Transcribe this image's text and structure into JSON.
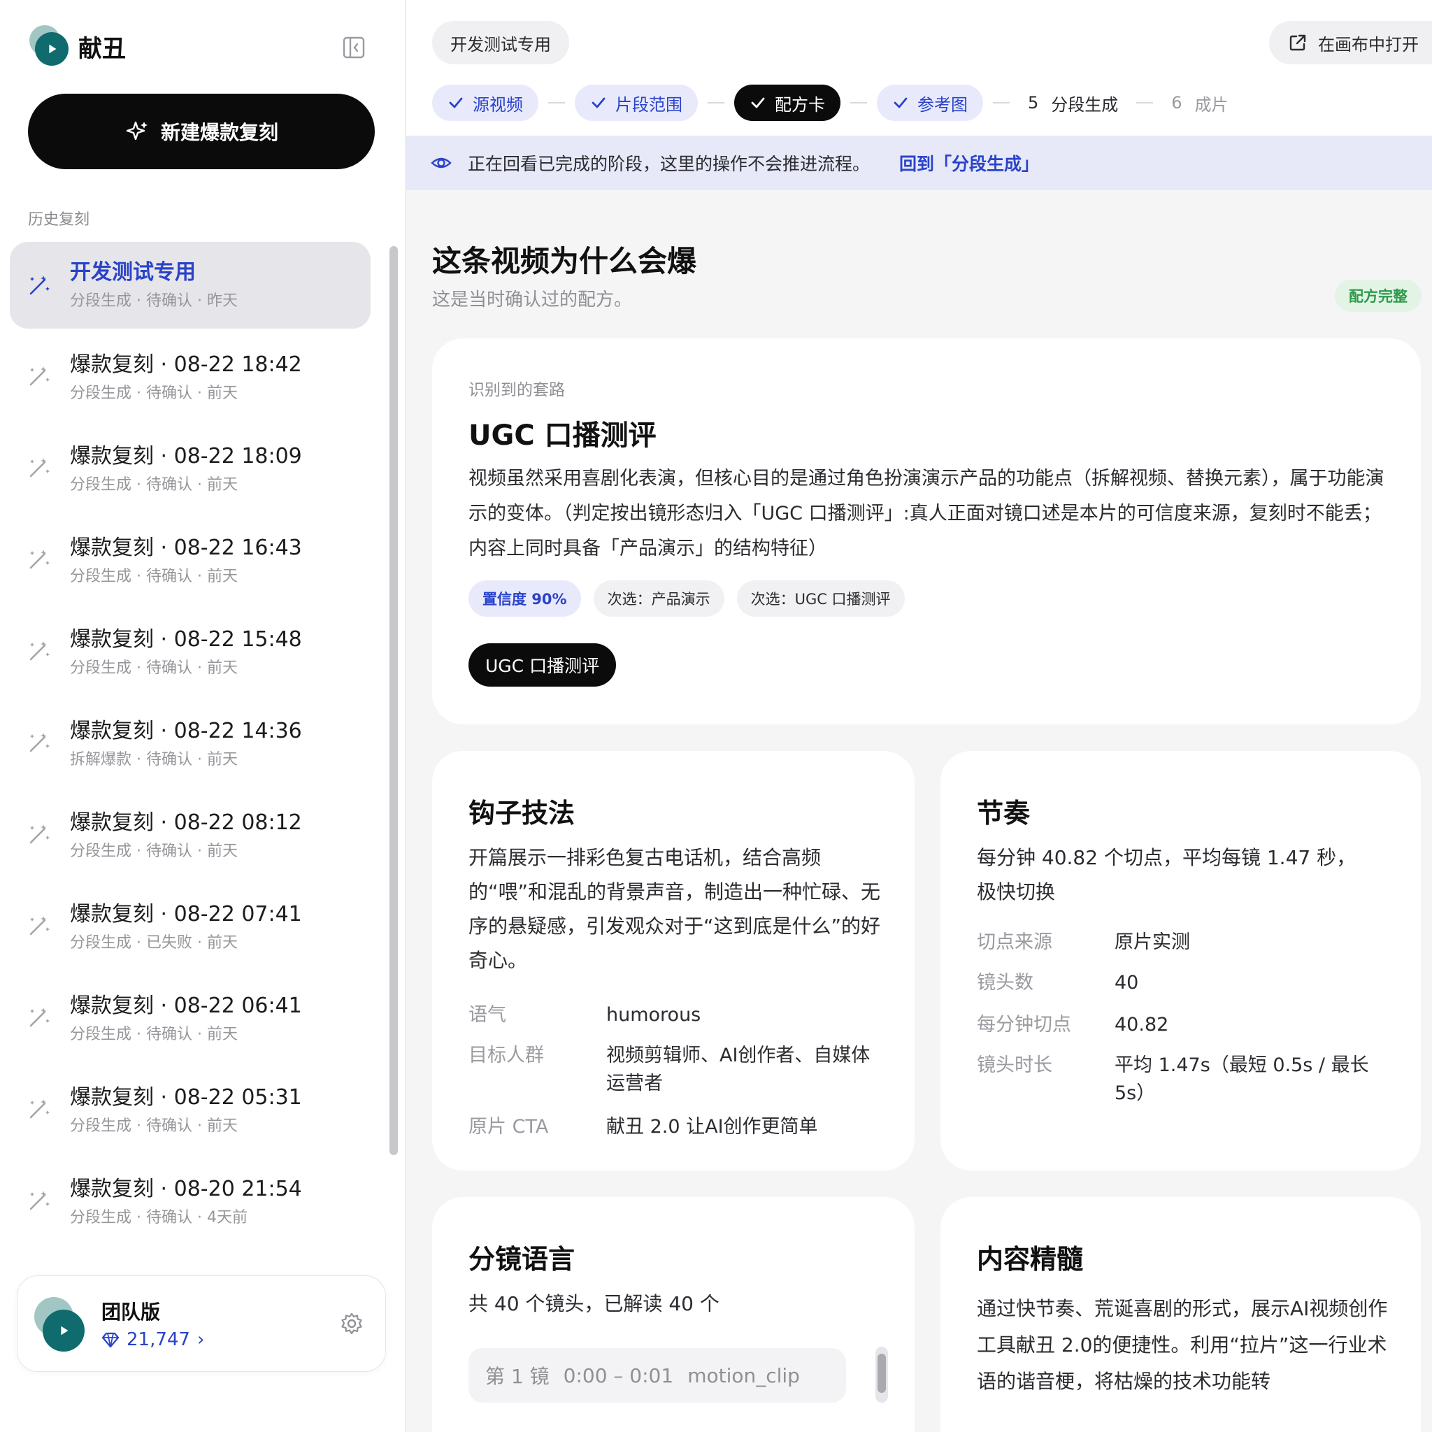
{
  "app": {
    "name": "献丑",
    "new_button": "新建爆款复刻",
    "history_title": "历史复刻"
  },
  "history": [
    {
      "title": "开发测试专用",
      "sub": "分段生成 · 待确认 · 昨天",
      "active": true
    },
    {
      "title": "爆款复刻 · 08-22 18:42",
      "sub": "分段生成 · 待确认 · 前天"
    },
    {
      "title": "爆款复刻 · 08-22 18:09",
      "sub": "分段生成 · 待确认 · 前天"
    },
    {
      "title": "爆款复刻 · 08-22 16:43",
      "sub": "分段生成 · 待确认 · 前天"
    },
    {
      "title": "爆款复刻 · 08-22 15:48",
      "sub": "分段生成 · 待确认 · 前天"
    },
    {
      "title": "爆款复刻 · 08-22 14:36",
      "sub": "拆解爆款 · 待确认 · 前天"
    },
    {
      "title": "爆款复刻 · 08-22 08:12",
      "sub": "分段生成 · 待确认 · 前天"
    },
    {
      "title": "爆款复刻 · 08-22 07:41",
      "sub": "分段生成 · 已失败 · 前天"
    },
    {
      "title": "爆款复刻 · 08-22 06:41",
      "sub": "分段生成 · 待确认 · 前天"
    },
    {
      "title": "爆款复刻 · 08-22 05:31",
      "sub": "分段生成 · 待确认 · 前天"
    },
    {
      "title": "爆款复刻 · 08-20 21:54",
      "sub": "分段生成 · 待确认 · 4天前"
    }
  ],
  "team": {
    "name": "团队版",
    "credits": "21,747",
    "credits_arrow": "›"
  },
  "header": {
    "project": "开发测试专用",
    "open_canvas": "在画布中打开"
  },
  "steps": [
    {
      "label": "源视频",
      "state": "done"
    },
    {
      "label": "片段范围",
      "state": "done"
    },
    {
      "label": "配方卡",
      "state": "current"
    },
    {
      "label": "参考图",
      "state": "done"
    },
    {
      "num": "5",
      "label": "分段生成",
      "state": "todo"
    },
    {
      "num": "6",
      "label": "成片",
      "state": "todo-dim"
    }
  ],
  "notice": {
    "text": "正在回看已完成的阶段，这里的操作不会推进流程。",
    "link": "回到「分段生成」"
  },
  "section": {
    "title": "这条视频为什么会爆",
    "subtitle": "这是当时确认过的配方。",
    "badge": "配方完整"
  },
  "routine": {
    "label": "识别到的套路",
    "name": "UGC 口播测评",
    "description": "视频虽然采用喜剧化表演，但核心目的是通过角色扮演演示产品的功能点（拆解视频、替换元素），属于功能演示的变体。（判定按出镜形态归入「UGC 口播测评」:真人正面对镜口述是本片的可信度来源，复刻时不能丢；内容上同时具备「产品演示」的结构特征）",
    "confidence": "置信度 90%",
    "alt1": "次选：产品演示",
    "alt2": "次选：UGC 口播测评",
    "chosen": "UGC 口播测评"
  },
  "hook": {
    "title": "钩子技法",
    "body": "开篇展示一排彩色复古电话机，结合高频的“喂”和混乱的背景声音，制造出一种忙碌、无序的悬疑感，引发观众对于“这到底是什么”的好奇心。",
    "rows": [
      {
        "k": "语气",
        "v": "humorous"
      },
      {
        "k": "目标人群",
        "v": "视频剪辑师、AI创作者、自媒体运营者"
      },
      {
        "k": "原片 CTA",
        "v": "献丑 2.0 让AI创作更简单"
      }
    ]
  },
  "rhythm": {
    "title": "节奏",
    "body": "每分钟 40.82 个切点，平均每镜 1.47 秒，极快切换",
    "rows": [
      {
        "k": "切点来源",
        "v": "原片实测"
      },
      {
        "k": "镜头数",
        "v": "40"
      },
      {
        "k": "每分钟切点",
        "v": "40.82"
      },
      {
        "k": "镜头时长",
        "v": "平均 1.47s（最短 0.5s / 最长 5s）"
      }
    ]
  },
  "storyboard": {
    "title": "分镜语言",
    "summary": "共 40 个镜头，已解读 40 个",
    "shot_label": "第 1 镜",
    "shot_time": "0:00 – 0:01",
    "shot_type": "motion_clip"
  },
  "essence": {
    "title": "内容精髓",
    "body": "通过快节奏、荒诞喜剧的形式，展示AI视频创作工具献丑 2.0的便捷性。利用“拉片”这一行业术语的谐音梗，将枯燥的技术功能转"
  }
}
